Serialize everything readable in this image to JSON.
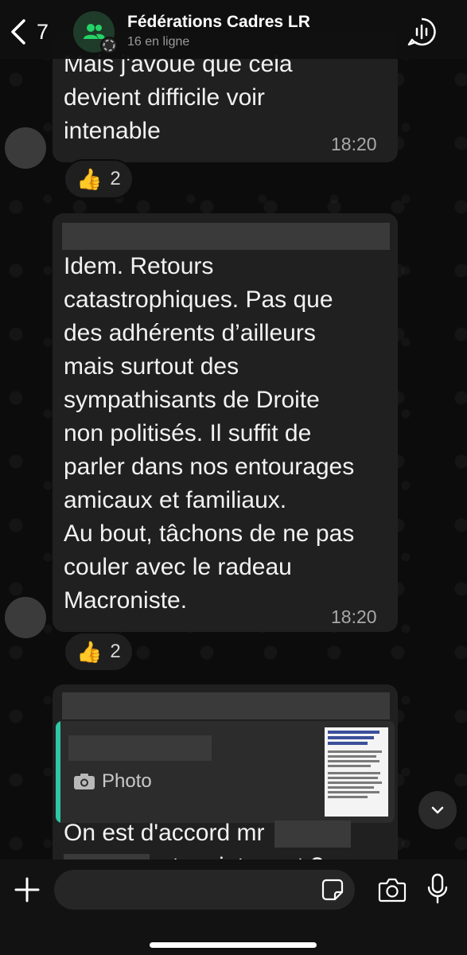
{
  "header": {
    "back_count": "7",
    "title": "Fédérations Cadres LR",
    "subtitle": "16 en ligne"
  },
  "messages": [
    {
      "text": "Mais j'avoue que cela\ndevient difficile voir\nintenable",
      "time": "18:20",
      "reaction": {
        "emoji": "👍",
        "count": "2"
      }
    },
    {
      "text": "Idem. Retours\ncatastrophiques. Pas que\ndes adhérents d’ailleurs\nmais surtout des\nsympathisants de Droite\nnon politisés. Il suffit de\nparler dans nos entourages\namicaux et familiaux.\nAu bout, tâchons de ne pas\ncouler avec le radeau\nMacroniste.",
      "time": "18:20",
      "reaction": {
        "emoji": "👍",
        "count": "2"
      }
    },
    {
      "quote": {
        "label": "Photo"
      },
      "text_start": "On est d'accord mr",
      "text_partial": "et maintenant ?"
    }
  ],
  "composer": {
    "placeholder": ""
  },
  "colors": {
    "accent_green": "#25d366",
    "quote_bar": "#2ec7a7",
    "bubble": "#202020"
  },
  "icons": [
    "chevron-left-icon",
    "group-icon",
    "voice-chat-icon",
    "camera-icon",
    "chevron-down-icon",
    "plus-icon",
    "sticker-icon",
    "microphone-icon"
  ]
}
